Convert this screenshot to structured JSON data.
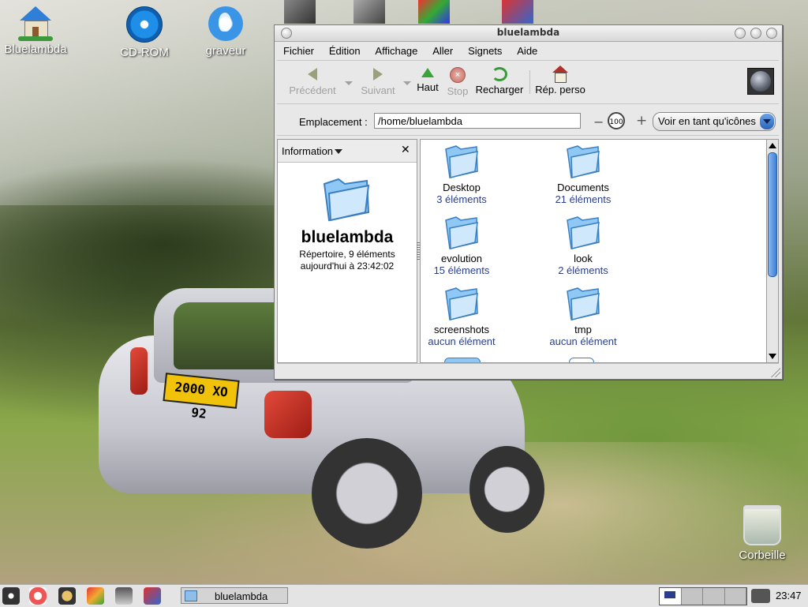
{
  "desktop": {
    "icons": [
      {
        "label": "Bluelambda",
        "icon": "home-icon"
      },
      {
        "label": "CD-ROM",
        "icon": "cdrom-icon"
      },
      {
        "label": "graveur",
        "icon": "burner-icon"
      },
      {
        "label": "Corbeille",
        "icon": "trash-icon"
      }
    ],
    "wallpaper_plate": "2000 XO 92"
  },
  "window": {
    "title": "bluelambda",
    "menu": [
      "Fichier",
      "Édition",
      "Affichage",
      "Aller",
      "Signets",
      "Aide"
    ],
    "toolbar": {
      "back": "Précédent",
      "forward": "Suivant",
      "up": "Haut",
      "stop": "Stop",
      "reload": "Recharger",
      "home": "Rép. perso"
    },
    "location": {
      "label": "Emplacement :",
      "value": "/home/bluelambda",
      "zoom": "100",
      "view_mode": "Voir en tant qu'icônes"
    },
    "sidepane": {
      "header": "Information",
      "name": "bluelambda",
      "kind": "Répertoire, 9 éléments",
      "date": "aujourd'hui à 23:42:02"
    },
    "files": [
      {
        "name": "Desktop",
        "count": "3 éléments"
      },
      {
        "name": "Documents",
        "count": "21 éléments"
      },
      {
        "name": "evolution",
        "count": "15 éléments"
      },
      {
        "name": "look",
        "count": "2 éléments"
      },
      {
        "name": "screenshots",
        "count": "aucun élément"
      },
      {
        "name": "tmp",
        "count": "aucun élément"
      }
    ]
  },
  "taskbar": {
    "task_label": "bluelambda",
    "clock": "23:47"
  },
  "colors": {
    "link_count": "#2a3e8c",
    "folder_blue": "#6fb4ee",
    "scroll_thumb": "#3b7fd6"
  }
}
